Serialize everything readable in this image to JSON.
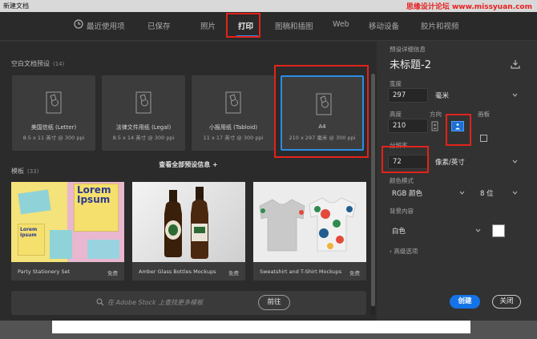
{
  "window": {
    "title": "新建文档",
    "watermark": "思缘设计论坛 www.missyuan.com"
  },
  "tabs": [
    {
      "label": "最近使用项"
    },
    {
      "label": "已保存"
    },
    {
      "label": "照片"
    },
    {
      "label": "打印"
    },
    {
      "label": "图稿和插图"
    },
    {
      "label": "Web"
    },
    {
      "label": "移动设备"
    },
    {
      "label": "胶片和视频"
    }
  ],
  "blank_presets": {
    "title": "空白文档预设",
    "count": "(14)",
    "items": [
      {
        "name": "美国信纸 (Letter)",
        "size": "8.5 x 11 英寸 @ 300 ppi"
      },
      {
        "name": "法律文件用纸 (Legal)",
        "size": "8.5 x 14 英寸 @ 300 ppi"
      },
      {
        "name": "小报用纸 (Tabloid)",
        "size": "11 x 17 英寸 @ 300 ppi"
      },
      {
        "name": "A4",
        "size": "210 x 297 毫米 @ 300 ppi"
      }
    ],
    "view_all": "查看全部预设信息 +"
  },
  "templates": {
    "title": "模板",
    "count": "(33)",
    "items": [
      {
        "name": "Party Stationery Set",
        "price": "免费",
        "thumb_text_1": "Lorem",
        "thumb_text_2": "Ipsum"
      },
      {
        "name": "Amber Glass Bottles Mockups",
        "price": "免费"
      },
      {
        "name": "Sweatshirt and T-Shirt Mockups",
        "price": "免费"
      }
    ]
  },
  "search": {
    "placeholder": "在 Adobe Stock 上查找更多模板",
    "go_label": "前往"
  },
  "details": {
    "header": "预设详细信息",
    "doc_name": "未标题-2",
    "width_label": "宽度",
    "width_value": "297",
    "width_unit": "毫米",
    "height_label": "高度",
    "height_value": "210",
    "orientation_label": "方向",
    "artboard_label": "画板",
    "resolution_label": "分辨率",
    "resolution_value": "72",
    "resolution_unit": "像素/英寸",
    "color_mode_label": "颜色模式",
    "color_mode_value": "RGB 颜色",
    "bit_depth_value": "8 位",
    "bg_label": "背景内容",
    "bg_value": "白色",
    "advanced_label": "高级选项",
    "create_label": "创建",
    "close_label": "关闭"
  },
  "colors": {
    "accent": "#1473e6",
    "highlight_red": "#e2231a",
    "selected_border": "#2b8ce6"
  }
}
